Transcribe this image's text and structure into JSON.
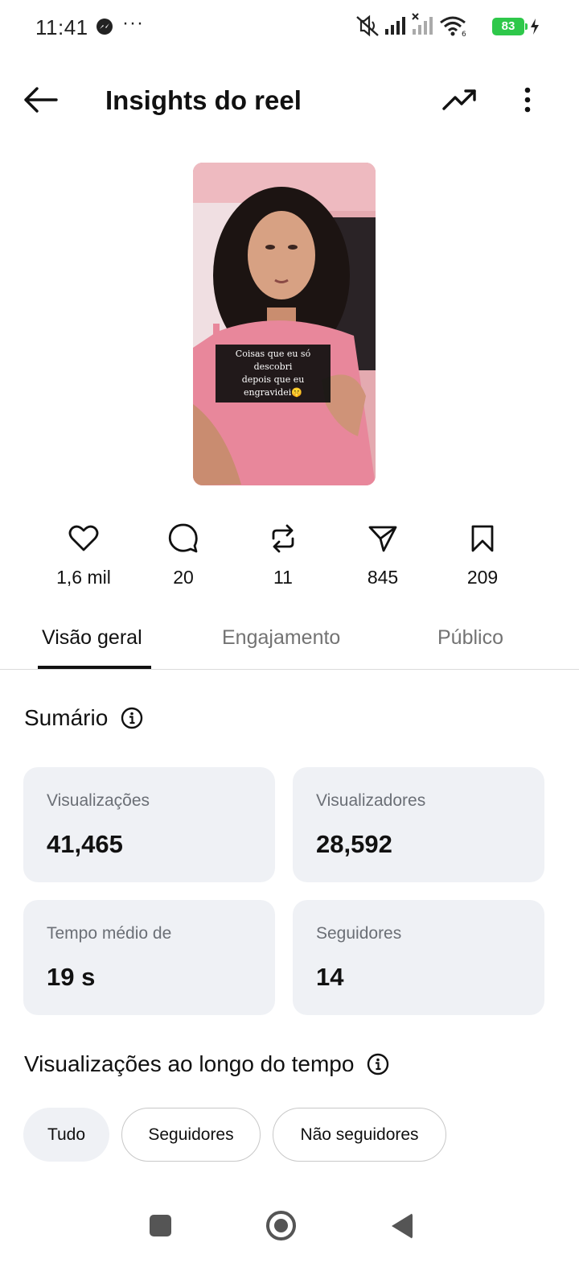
{
  "status_bar": {
    "time": "11:41",
    "notification_icons": [
      "messenger-icon",
      "more-dots-icon"
    ],
    "system_icons": [
      "mute-icon",
      "signal-icon",
      "signal-no-service-icon",
      "wifi-icon",
      "charging-icon"
    ],
    "overflow": "···",
    "battery": "83"
  },
  "header": {
    "title": "Insights do reel",
    "back_icon": "back-arrow-icon",
    "trend_icon": "trending-icon",
    "more_icon": "more-vertical-icon"
  },
  "reel": {
    "caption_line1": "Coisas que eu só descobri",
    "caption_line2": "depois que eu engravidei🤫"
  },
  "stats": [
    {
      "icon": "heart-icon",
      "value": "1,6 mil"
    },
    {
      "icon": "comment-icon",
      "value": "20"
    },
    {
      "icon": "repost-icon",
      "value": "11"
    },
    {
      "icon": "share-icon",
      "value": "845"
    },
    {
      "icon": "bookmark-icon",
      "value": "209"
    }
  ],
  "tabs": [
    {
      "label": "Visão geral",
      "active": true
    },
    {
      "label": "Engajamento",
      "active": false
    },
    {
      "label": "Público",
      "active": false
    }
  ],
  "summary": {
    "title": "Sumário",
    "cards": [
      {
        "label": "Visualizações",
        "value": "41,465"
      },
      {
        "label": "Visualizadores",
        "value": "28,592"
      },
      {
        "label": "Tempo médio de",
        "value": "19 s"
      },
      {
        "label": "Seguidores",
        "value": "14"
      }
    ]
  },
  "views_over_time": {
    "title": "Visualizações ao longo do tempo",
    "filters": [
      {
        "label": "Tudo",
        "selected": true
      },
      {
        "label": "Seguidores",
        "selected": false
      },
      {
        "label": "Não seguidores",
        "selected": false
      }
    ]
  },
  "colors": {
    "battery": "#2ec84a",
    "card_bg": "#eff1f5",
    "muted_text": "#737373",
    "thumbnail_dress": "#e8879b"
  }
}
